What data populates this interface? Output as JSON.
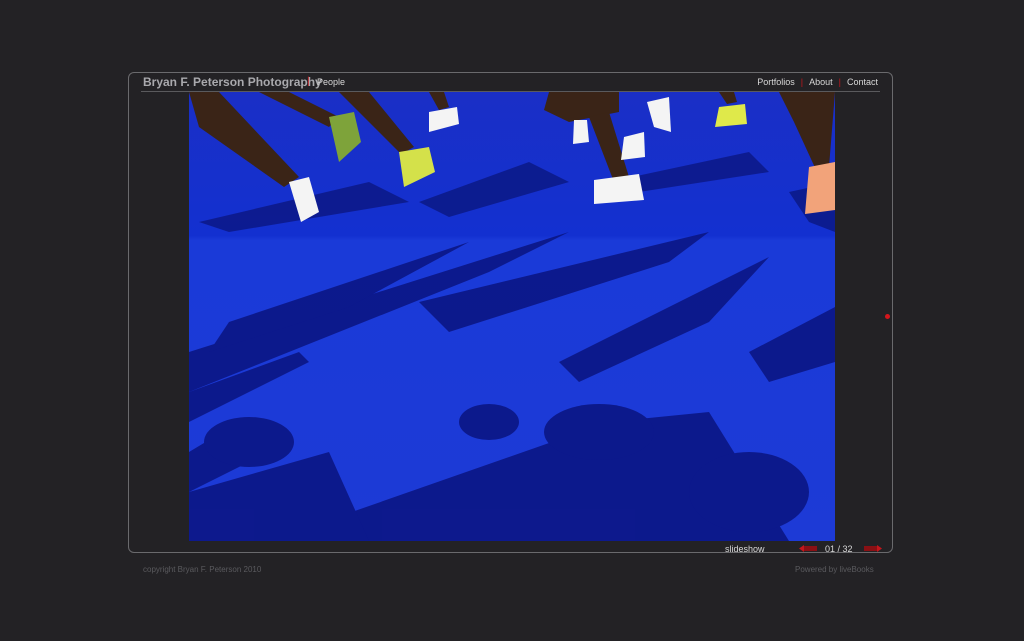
{
  "header": {
    "site_title": "Bryan F. Peterson Photography",
    "gallery_name": "People",
    "nav": [
      {
        "label": "Portfolios"
      },
      {
        "label": "About"
      },
      {
        "label": "Contact"
      }
    ]
  },
  "viewer": {
    "slideshow_label": "slideshow",
    "counter": "01 / 32"
  },
  "footer": {
    "copyright": "copyright Bryan F. Peterson 2010",
    "powered_by": "Powered by liveBooks"
  },
  "colors": {
    "background": "#232225",
    "accent_red": "#c4161c",
    "photo_blue": "#1a2dc8"
  }
}
